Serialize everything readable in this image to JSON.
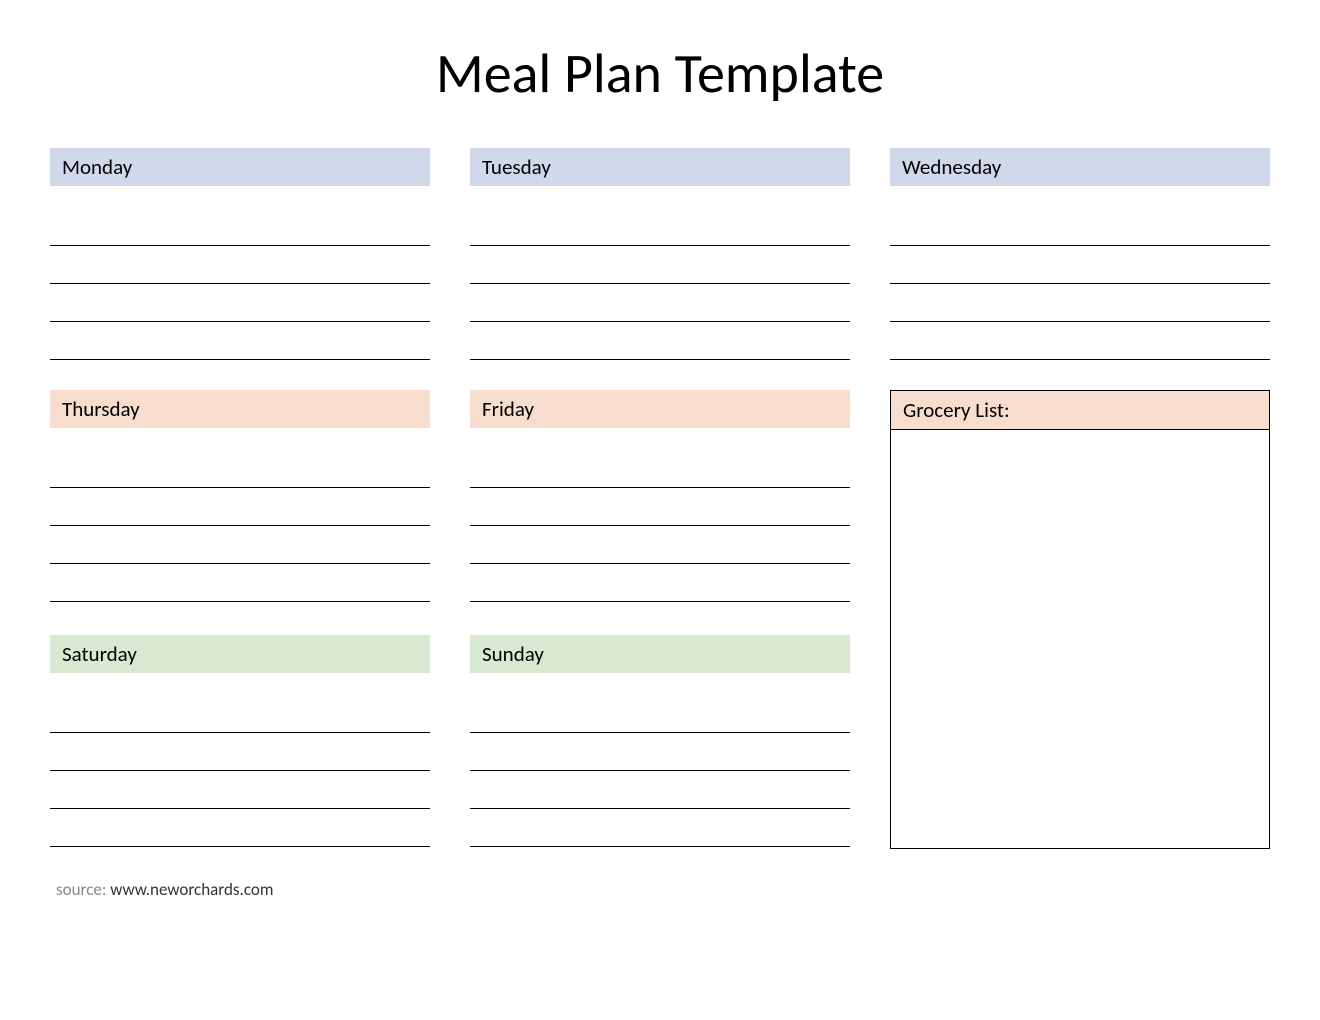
{
  "title": "Meal Plan Template",
  "days": {
    "monday": {
      "label": "Monday",
      "color": "blue"
    },
    "tuesday": {
      "label": "Tuesday",
      "color": "blue"
    },
    "wednesday": {
      "label": "Wednesday",
      "color": "blue"
    },
    "thursday": {
      "label": "Thursday",
      "color": "peach"
    },
    "friday": {
      "label": "Friday",
      "color": "peach"
    },
    "saturday": {
      "label": "Saturday",
      "color": "green"
    },
    "sunday": {
      "label": "Sunday",
      "color": "green"
    }
  },
  "grocery": {
    "label": "Grocery List:"
  },
  "footer": {
    "source_label": "source: ",
    "url": "www.neworchards.com"
  },
  "lines_per_day": 4
}
